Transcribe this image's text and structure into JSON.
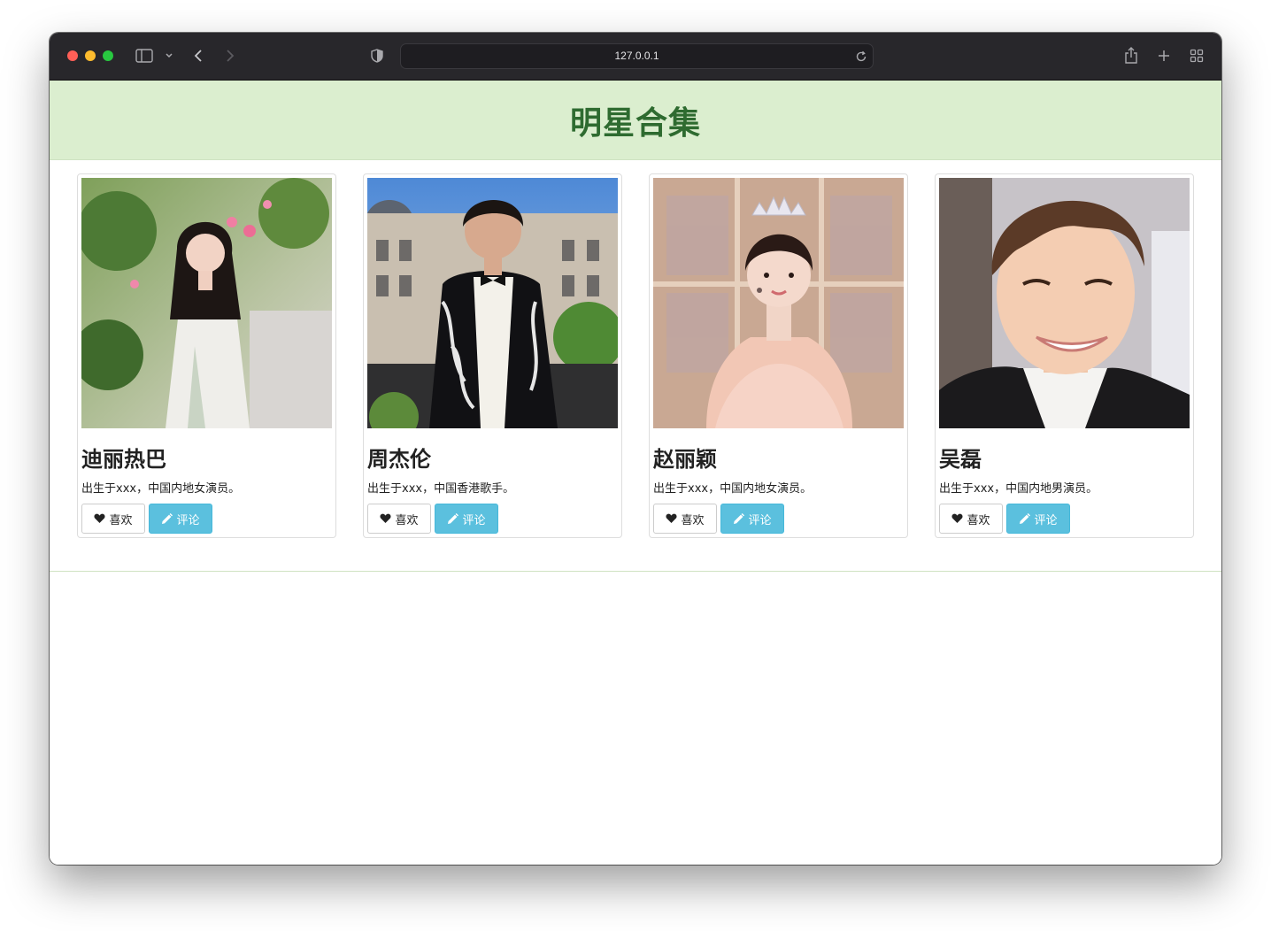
{
  "browser": {
    "url": "127.0.0.1"
  },
  "colors": {
    "header_bg": "#dbeecf",
    "title": "#2e6b30",
    "comment_button": "#5bc0de"
  },
  "page": {
    "title": "明星合集"
  },
  "cards": [
    {
      "name": "迪丽热巴",
      "desc": "出生于xxx，中国内地女演员。",
      "like_label": "喜欢",
      "comment_label": "评论",
      "photo": "portrait-woman-flowers"
    },
    {
      "name": "周杰伦",
      "desc": "出生于xxx，中国香港歌手。",
      "like_label": "喜欢",
      "comment_label": "评论",
      "photo": "portrait-man-suit"
    },
    {
      "name": "赵丽颖",
      "desc": "出生于xxx，中国内地女演员。",
      "like_label": "喜欢",
      "comment_label": "评论",
      "photo": "portrait-woman-tiara"
    },
    {
      "name": "吴磊",
      "desc": "出生于xxx，中国内地男演员。",
      "like_label": "喜欢",
      "comment_label": "评论",
      "photo": "portrait-man-smile"
    }
  ],
  "icons": {
    "like": "heart-icon",
    "comment": "pencil-icon"
  }
}
